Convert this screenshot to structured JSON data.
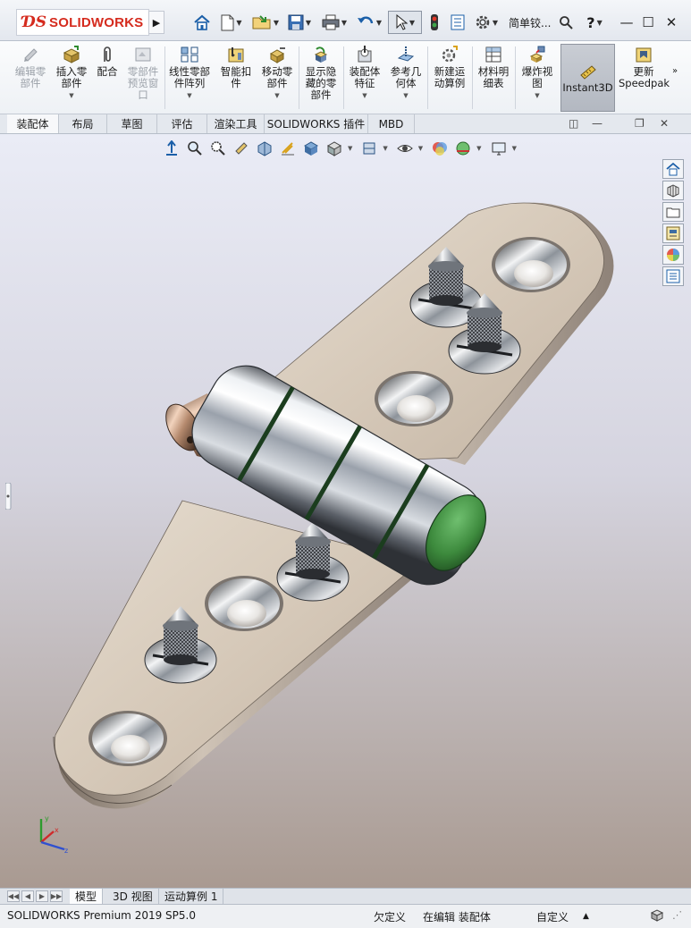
{
  "app": {
    "logo_text": "SOLIDWORKS",
    "window_title": "简单铰..."
  },
  "quick_access": [
    "home-icon",
    "new-document-icon",
    "open-icon",
    "save-icon",
    "print-icon",
    "undo-icon",
    "select-icon",
    "rebuild-icon",
    "file-properties-icon",
    "options-icon"
  ],
  "ribbon": {
    "edit_component": "编辑零部件",
    "insert_components": "插入零部件",
    "mate": "配合",
    "component_preview": "零部件预览窗口",
    "linear_pattern": "线性零部件阵列",
    "smart_fasteners": "智能扣件",
    "move_component": "移动零部件",
    "show_hidden": "显示隐藏的零部件",
    "assembly_features": "装配体特征",
    "reference_geometry": "参考几何体",
    "new_motion_study": "新建运动算例",
    "bill_of_materials": "材料明细表",
    "exploded_view": "爆炸视图",
    "instant3d": "Instant3D",
    "update_speedpak": "更新Speedpak"
  },
  "tabs": [
    "装配体",
    "布局",
    "草图",
    "评估",
    "渲染工具",
    "SOLIDWORKS 插件",
    "MBD"
  ],
  "bottom_tabs": [
    "模型",
    "3D 视图",
    "运动算例 1"
  ],
  "status": {
    "product": "SOLIDWORKS Premium 2019 SP5.0",
    "definition": "欠定义",
    "editing": "在编辑 装配体",
    "units": "自定义"
  },
  "triad": {
    "x": "x",
    "y": "y",
    "z": "z"
  },
  "colors": {
    "brand_red": "#d52b1e",
    "plate": "#d6c9ba",
    "steel": "#b8bec6",
    "endcap": "#3d8a3d"
  }
}
